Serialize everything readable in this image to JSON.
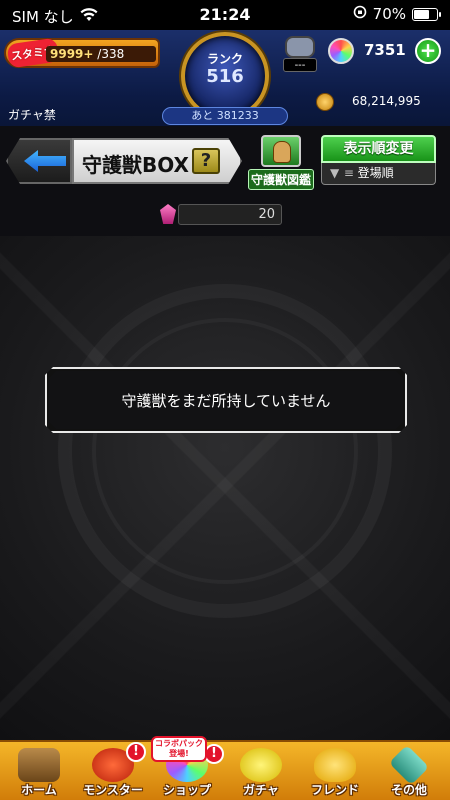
{
  "status_bar": {
    "carrier": "SIM なし",
    "time": "21:24",
    "battery": "70%",
    "battery_level": 0.7
  },
  "header": {
    "stamina_label": "スタミナ",
    "stamina_current": "9999+",
    "stamina_max": "/338",
    "rank_label": "ランク",
    "rank_value": "516",
    "rank_next": "あと 381233",
    "friend_status": "---",
    "orb_count": "7351",
    "gacha_ban": "ガチャ禁",
    "gold": "68,214,995"
  },
  "titlebar": {
    "title": "守護獣BOX",
    "help": "?",
    "encyclopedia_label": "守護獣図鑑",
    "sort_label": "表示順変更",
    "sort_value": "登場順"
  },
  "capacity": {
    "value": "20"
  },
  "main": {
    "empty_message": "守護獣をまだ所持していません"
  },
  "bottom_nav": {
    "items": [
      {
        "label": "ホーム"
      },
      {
        "label": "モンスター"
      },
      {
        "label": "ショップ"
      },
      {
        "label": "ガチャ"
      },
      {
        "label": "フレンド"
      },
      {
        "label": "その他"
      }
    ],
    "collab_tag": "コラボパック登場!",
    "badge": "!"
  },
  "colors": {
    "header_bg": "#1b2f6a",
    "nav_bg": "#f4b629",
    "sort_green": "#4ed04e",
    "badge_red": "#e3132b"
  }
}
